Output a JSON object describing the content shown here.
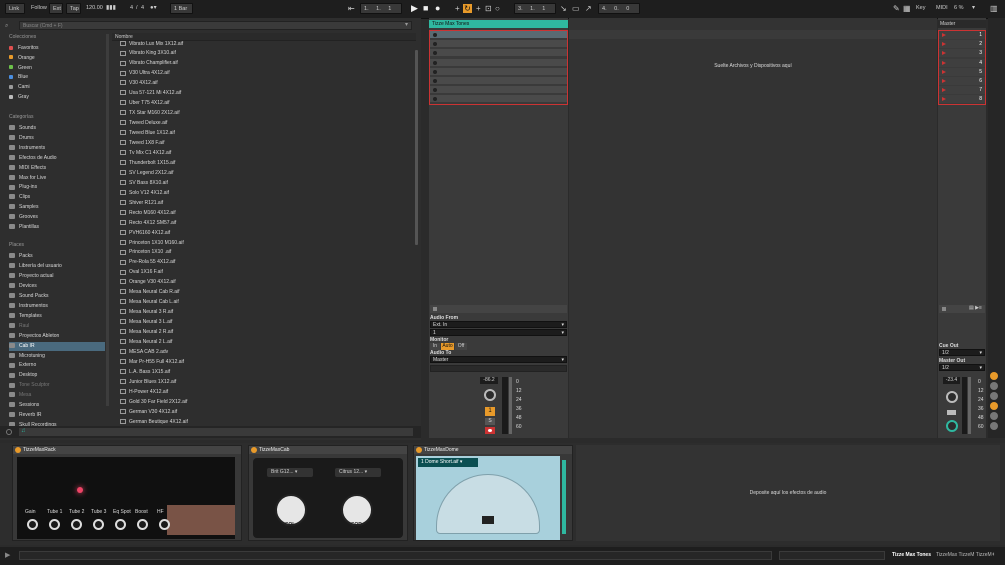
{
  "transport": {
    "link": "Link",
    "follow": "Follow",
    "ext": "Ext",
    "tap": "Tap",
    "tempo": "120.00",
    "time_sig_num": "4",
    "time_sig_den": "4",
    "quantize": "1 Bar",
    "pos1": "1",
    "pos2": "1",
    "pos3": "1",
    "arr_pos1": "3",
    "arr_pos2": "1",
    "arr_pos3": "1",
    "loop_len1": "4",
    "loop_len2": "0",
    "loop_len3": "0",
    "key": "Key",
    "midi": "MIDI",
    "cpu": "6 %"
  },
  "browser": {
    "search_placeholder": "Buscar (Cmd + F)",
    "collections_header": "Colecciones",
    "collections": [
      {
        "label": "Favoritos",
        "color": "#e05050"
      },
      {
        "label": "Orange",
        "color": "#e89a2a"
      },
      {
        "label": "Green",
        "color": "#6cc04a"
      },
      {
        "label": "Blue",
        "color": "#4a8ee0"
      },
      {
        "label": "Cami",
        "color": "#9a9a9a"
      },
      {
        "label": "Gray",
        "color": "#bbbbbb"
      }
    ],
    "categories_header": "Categorías",
    "categories": [
      "Sounds",
      "Drums",
      "Instruments",
      "Efectos de Audio",
      "MIDI Effects",
      "Max for Live",
      "Plug-ins",
      "Clips",
      "Samples",
      "Grooves",
      "Plantillas"
    ],
    "places_header": "Places",
    "places": [
      {
        "label": "Packs",
        "dim": false
      },
      {
        "label": "Librería del usuario",
        "dim": false
      },
      {
        "label": "Proyecto actual",
        "dim": false
      },
      {
        "label": "Devices",
        "dim": false
      },
      {
        "label": "Sound Packs",
        "dim": false
      },
      {
        "label": "Instrumentos",
        "dim": false
      },
      {
        "label": "Templates",
        "dim": false
      },
      {
        "label": "Raul",
        "dim": true
      },
      {
        "label": "Proyectos Ableton",
        "dim": false
      },
      {
        "label": "Cab IR",
        "dim": false,
        "selected": true
      },
      {
        "label": "Microtuning",
        "dim": false
      },
      {
        "label": "Externo",
        "dim": false
      },
      {
        "label": "Desktop",
        "dim": false
      },
      {
        "label": "Tone Sculptor",
        "dim": true
      },
      {
        "label": "Mesa",
        "dim": true
      },
      {
        "label": "Sessions",
        "dim": false
      },
      {
        "label": "Reverb IR",
        "dim": false
      },
      {
        "label": "Skull Recordings",
        "dim": false
      }
    ],
    "column_name": "Nombre",
    "files": [
      "Vibrato Lux Mix 1X12.aif",
      "Vibrato King 3X10.aif",
      "Vibrato Champlifier.aif",
      "V30 Ultra 4X12.aif",
      "V30 4X12.aif",
      "Usa 57-121 Mi 4X12.aif",
      "Uber T75 4X12.aif",
      "TX Star M160 2X12.aif",
      "Tweed Deluxe.aif",
      "Tweed Blue 1X12.aif",
      "Tweed 1X8 F.aif",
      "Tv Mix C1 4X12.aif",
      "Thunderbolt 1X15.aif",
      "SV Legend 2X12.aif",
      "SV Bass 8X10.aif",
      "Solo V12 4X12.aif",
      "Shiver R121.aif",
      "Recto M160 4X12.aif",
      "Recto 4X12 SM57.aif",
      "PVH6160 4X12.aif",
      "Princeton 1X10 M160.aif",
      "Princeton 1X10 .aif",
      "Pre-Rola 55 4X12.aif",
      "Oval 1X16 F.aif",
      "Orange V30 4X12.aif",
      "Mesa Neural Cab R.aif",
      "Mesa Neural Cab L.aif",
      "Mesa Neural 3 R.aif",
      "Mesa Neural 3 L.aif",
      "Mesa Neural 2 R.aif",
      "Mesa Neural 2 L.aif",
      "MESA CAB 2.adv",
      "Mar Pr-H55 Full 4X12.aif",
      "L.A. Bass 1X15.aif",
      "Junior Blues 1X12.aif",
      "H-Power 4X12.aif",
      "Gold 30 Far Field 2X12.aif",
      "German V30 4X12.aif",
      "German Beutique 4X12.aif"
    ]
  },
  "session": {
    "track_title": "Tizze Max Tones",
    "drop_text": "Suelte Archivos y Dispositivos aquí",
    "master_title": "Master",
    "scene_numbers": [
      "1",
      "2",
      "3",
      "4",
      "5",
      "6",
      "7",
      "8"
    ],
    "audio_from_label": "Audio From",
    "audio_from_value": "Ext. In",
    "audio_from_channel": "1",
    "monitor_label": "Monitor",
    "monitor_in": "In",
    "monitor_auto": "Auto",
    "monitor_off": "Off",
    "audio_to_label": "Audio To",
    "audio_to_value": "Master",
    "track_volume": "-86.2",
    "track_number": "1",
    "solo": "S",
    "meter_scale": [
      "0",
      "12",
      "24",
      "36",
      "48",
      "60"
    ],
    "cue_out_label": "Cue Out",
    "cue_out_value": "1/2",
    "master_out_label": "Master Out",
    "master_out_value": "1/2",
    "master_volume": "-23.4",
    "master_meter_scale": [
      "0",
      "12",
      "24",
      "36",
      "48",
      "60"
    ]
  },
  "devices": {
    "rack_title": "TizzeMaxRack",
    "rack_controls": [
      "Gain",
      "Tube 1",
      "Tube 2",
      "Tube 3",
      "Eq Spot",
      "Boost",
      "HF"
    ],
    "cab_title": "TizzeMaxCab",
    "cab_left_select": "Brit G12...",
    "cab_right_select": "Citrus 12...",
    "cab_left_knob": "SOL",
    "cab_right_knob": "SOR",
    "dome_title": "TizzeMaxDome",
    "dome_select": "1 Dome Short.aif",
    "drop_effects": "Deposite aquí los efectos de audio"
  },
  "footer": {
    "track_name": "Tizze Max Tones",
    "device_chain": "TizzeMax TizzeM TizzeM"
  },
  "colors": {
    "accent": "#2fb8a0",
    "record": "#cc3333",
    "orange": "#e89a2a"
  }
}
